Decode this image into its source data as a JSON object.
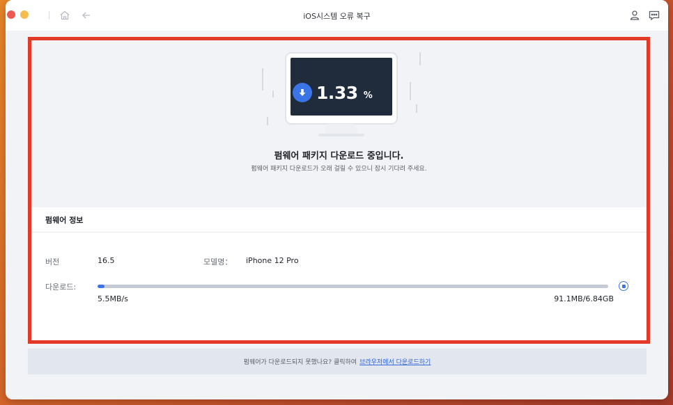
{
  "window": {
    "title": "iOS시스템 오류 복구"
  },
  "hero": {
    "percent_value": "1.33",
    "percent_unit": "%",
    "title": "펌웨어 패키지 다운로드 중입니다.",
    "subtitle": "펌웨어 패키지 다운로드가 오래 걸릴 수 있으니 잠시 기다려 주세요."
  },
  "info": {
    "heading": "펌웨어 정보",
    "version_label": "버전",
    "version_value": "16.5",
    "model_label": "모델명：",
    "model_value": "iPhone 12 Pro",
    "download_label": "다운로드:",
    "download_speed": "5.5MB/s",
    "download_size": "91.1MB/6.84GB",
    "progress_fraction": 0.0133
  },
  "footer": {
    "text": "펌웨어가 다운로드되지 못했나요? 클릭하여",
    "link": "브라우저에서 다운로드하기"
  },
  "colors": {
    "accent": "#3a74e6",
    "highlight_border": "#e23a26"
  }
}
